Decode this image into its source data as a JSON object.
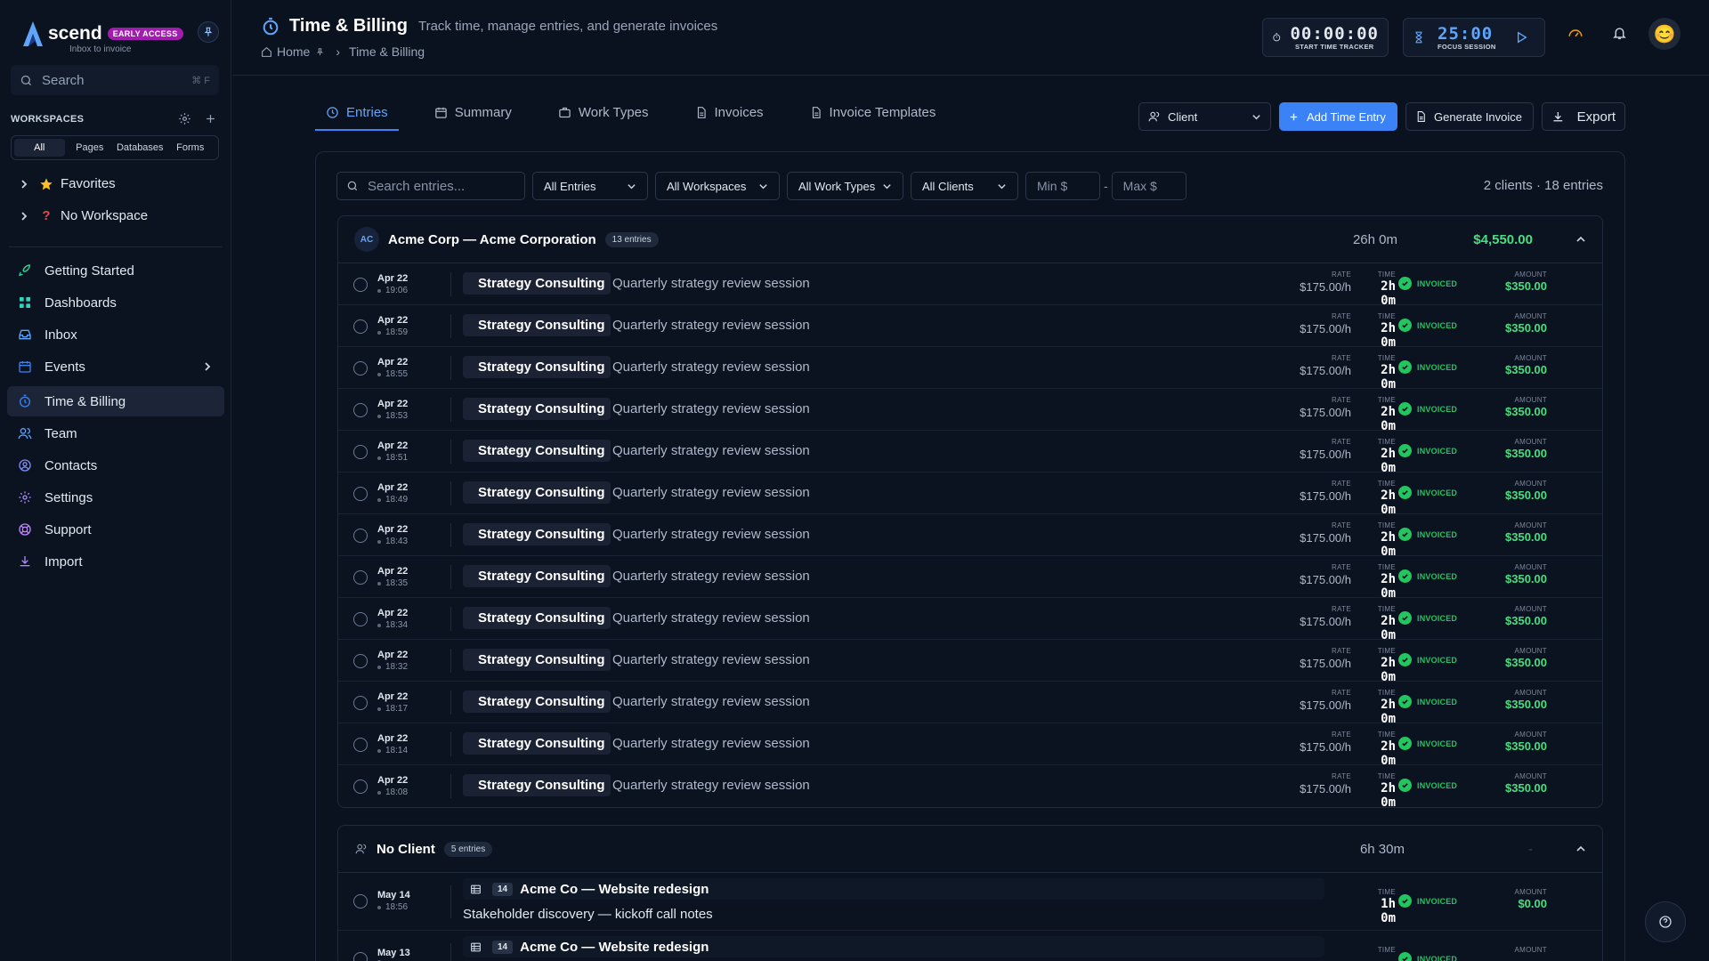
{
  "app": {
    "brand": "scend",
    "badge": "EARLY ACCESS",
    "tagline": "Inbox to invoice"
  },
  "sidebar": {
    "search_placeholder": "Search",
    "search_shortcut": "⌘ F",
    "workspaces_label": "WORKSPACES",
    "ws_tabs": [
      "All",
      "Pages",
      "Databases",
      "Forms"
    ],
    "tree": [
      {
        "label": "Favorites",
        "icon": "star-icon"
      },
      {
        "label": "No Workspace",
        "icon": "question-icon"
      }
    ],
    "nav": [
      {
        "label": "Getting Started",
        "icon": "rocket-icon"
      },
      {
        "label": "Dashboards",
        "icon": "grid-icon"
      },
      {
        "label": "Inbox",
        "icon": "inbox-icon"
      },
      {
        "label": "Events",
        "icon": "calendar-icon"
      },
      {
        "label": "Time & Billing",
        "icon": "stopwatch-icon"
      },
      {
        "label": "Team",
        "icon": "team-icon"
      },
      {
        "label": "Contacts",
        "icon": "contacts-icon"
      },
      {
        "label": "Settings",
        "icon": "gear-icon"
      },
      {
        "label": "Support",
        "icon": "support-icon"
      },
      {
        "label": "Import",
        "icon": "import-icon"
      }
    ]
  },
  "header": {
    "title": "Time & Billing",
    "subtitle": "Track time, manage entries, and generate invoices",
    "breadcrumb": [
      "Home",
      "Time & Billing"
    ],
    "tracker_time": "00:00:00",
    "tracker_label": "START TIME TRACKER",
    "focus_time": "25:00",
    "focus_label": "FOCUS SESSION"
  },
  "tabs": [
    "Entries",
    "Summary",
    "Work Types",
    "Invoices",
    "Invoice Templates"
  ],
  "toolbar": {
    "client_select": "Client",
    "add_label": "Add Time Entry",
    "generate_label": "Generate Invoice",
    "export_label": "Export"
  },
  "filters": {
    "search_placeholder": "Search entries...",
    "entries": "All Entries",
    "workspaces": "All Workspaces",
    "work_types": "All Work Types",
    "clients": "All Clients",
    "min_placeholder": "Min $",
    "max_placeholder": "Max $",
    "summary": "2 clients · 18 entries"
  },
  "labels": {
    "rate": "RATE",
    "time": "TIME",
    "amount": "AMOUNT"
  },
  "groups": [
    {
      "initials": "AC",
      "name": "Acme Corp — Acme Corporation",
      "count": "13 entries",
      "hours": "26h 0m",
      "total": "$4,550.00",
      "entries": [
        {
          "date": "Apr 22",
          "time": "19:06",
          "work_type": "Strategy Consulting",
          "desc": "Quarterly strategy review session",
          "rate": "$175.00/h",
          "duration": "2h 0m",
          "status": "INVOICED",
          "amount": "$350.00"
        },
        {
          "date": "Apr 22",
          "time": "18:59",
          "work_type": "Strategy Consulting",
          "desc": "Quarterly strategy review session",
          "rate": "$175.00/h",
          "duration": "2h 0m",
          "status": "INVOICED",
          "amount": "$350.00"
        },
        {
          "date": "Apr 22",
          "time": "18:55",
          "work_type": "Strategy Consulting",
          "desc": "Quarterly strategy review session",
          "rate": "$175.00/h",
          "duration": "2h 0m",
          "status": "INVOICED",
          "amount": "$350.00"
        },
        {
          "date": "Apr 22",
          "time": "18:53",
          "work_type": "Strategy Consulting",
          "desc": "Quarterly strategy review session",
          "rate": "$175.00/h",
          "duration": "2h 0m",
          "status": "INVOICED",
          "amount": "$350.00"
        },
        {
          "date": "Apr 22",
          "time": "18:51",
          "work_type": "Strategy Consulting",
          "desc": "Quarterly strategy review session",
          "rate": "$175.00/h",
          "duration": "2h 0m",
          "status": "INVOICED",
          "amount": "$350.00"
        },
        {
          "date": "Apr 22",
          "time": "18:49",
          "work_type": "Strategy Consulting",
          "desc": "Quarterly strategy review session",
          "rate": "$175.00/h",
          "duration": "2h 0m",
          "status": "INVOICED",
          "amount": "$350.00"
        },
        {
          "date": "Apr 22",
          "time": "18:43",
          "work_type": "Strategy Consulting",
          "desc": "Quarterly strategy review session",
          "rate": "$175.00/h",
          "duration": "2h 0m",
          "status": "INVOICED",
          "amount": "$350.00"
        },
        {
          "date": "Apr 22",
          "time": "18:35",
          "work_type": "Strategy Consulting",
          "desc": "Quarterly strategy review session",
          "rate": "$175.00/h",
          "duration": "2h 0m",
          "status": "INVOICED",
          "amount": "$350.00"
        },
        {
          "date": "Apr 22",
          "time": "18:34",
          "work_type": "Strategy Consulting",
          "desc": "Quarterly strategy review session",
          "rate": "$175.00/h",
          "duration": "2h 0m",
          "status": "INVOICED",
          "amount": "$350.00"
        },
        {
          "date": "Apr 22",
          "time": "18:32",
          "work_type": "Strategy Consulting",
          "desc": "Quarterly strategy review session",
          "rate": "$175.00/h",
          "duration": "2h 0m",
          "status": "INVOICED",
          "amount": "$350.00"
        },
        {
          "date": "Apr 22",
          "time": "18:17",
          "work_type": "Strategy Consulting",
          "desc": "Quarterly strategy review session",
          "rate": "$175.00/h",
          "duration": "2h 0m",
          "status": "INVOICED",
          "amount": "$350.00"
        },
        {
          "date": "Apr 22",
          "time": "18:14",
          "work_type": "Strategy Consulting",
          "desc": "Quarterly strategy review session",
          "rate": "$175.00/h",
          "duration": "2h 0m",
          "status": "INVOICED",
          "amount": "$350.00"
        },
        {
          "date": "Apr 22",
          "time": "18:08",
          "work_type": "Strategy Consulting",
          "desc": "Quarterly strategy review session",
          "rate": "$175.00/h",
          "duration": "2h 0m",
          "status": "INVOICED",
          "amount": "$350.00"
        }
      ]
    },
    {
      "name": "No Client",
      "count": "5 entries",
      "hours": "6h 30m",
      "total": "-",
      "entries": [
        {
          "date": "May 14",
          "time": "18:56",
          "project_num": "14",
          "project": "Acme Co — Website redesign",
          "desc": "Stakeholder discovery — kickoff call notes",
          "duration": "1h 0m",
          "status": "INVOICED",
          "amount": "$0.00"
        },
        {
          "date": "May 13",
          "time": "",
          "project_num": "14",
          "project": "Acme Co — Website redesign",
          "desc": "",
          "duration": "",
          "status": "INVOICED",
          "amount": ""
        }
      ]
    }
  ],
  "colors": {
    "accent": "#3b82f6",
    "success": "#22c55e",
    "money": "#4ade80",
    "badge": "#a21caf",
    "background": "#0a1220"
  }
}
